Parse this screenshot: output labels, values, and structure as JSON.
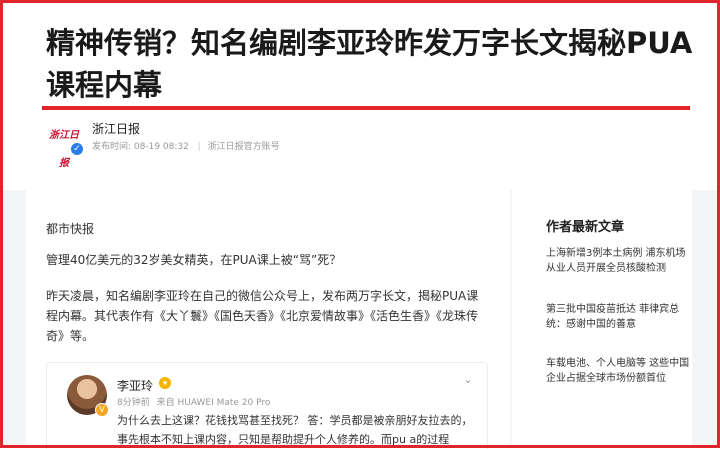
{
  "article": {
    "title": "精神传销？知名编剧李亚玲昨发万字长文揭秘PUA课程内幕",
    "source": {
      "logo_text": "浙江日报",
      "name": "浙江日报",
      "publish_label": "发布时间: 08-19  08:32",
      "account_label": "浙江日报官方账号"
    },
    "section": "都市快报",
    "paragraphs": [
      "管理40亿美元的32岁美女精英，在PUA课上被“骂”死？",
      "昨天凌晨，知名编剧李亚玲在自己的微信公众号上，发布两万字长文，揭秘PUA课程内幕。其代表作有《大丫鬟》《国色天香》《北京爱情故事》《活色生香》《龙珠传奇》等。"
    ],
    "embed": {
      "name": "李亚玲",
      "time": "8分钟前",
      "device": "来自 HUAWEI Mate 20 Pro",
      "text": "为什么去上这课？花钱找骂甚至找死？ 答：学员都是被亲朋好友拉去的，事先根本不知上课内容，只知是帮助提升个人修养的。而pu a的过程"
    }
  },
  "sidebar": {
    "title": "作者最新文章",
    "items": [
      "上海新增3例本土病例 浦东机场从业人员开展全员核酸检测",
      "第三批中国疫苗抵达 菲律宾总统：感谢中国的善意",
      "车载电池、个人电脑等 这些中国企业占据全球市场份额首位"
    ]
  },
  "colors": {
    "accent": "#e0252b",
    "verify": "#2b7de9",
    "background_band": "#f4f5f6"
  },
  "icons": {
    "verified": "verified-icon",
    "vip": "vip-badge-icon",
    "expand": "chevron-down-icon"
  }
}
